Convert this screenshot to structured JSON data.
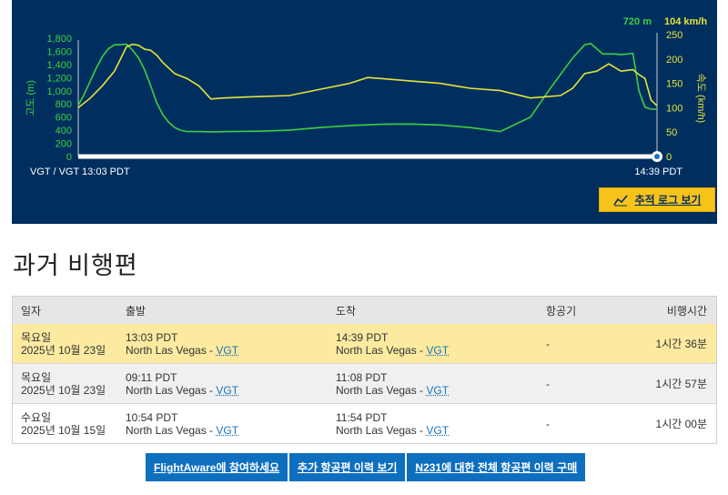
{
  "chart": {
    "altitude_readout": "720 m",
    "speed_readout": "104 km/h",
    "altitude_axis_label": "고도 (m)",
    "speed_axis_label": "속도 (km/h)",
    "start_label": "VGT / VGT 13:03 PDT",
    "end_label": "14:39 PDT",
    "tracklog_button": "추적 로그 보기",
    "colors": {
      "background": "#002f5f",
      "altitude": "#3fcf3f",
      "speed": "#e4e43a",
      "baseline": "#ffffff"
    }
  },
  "chart_data": {
    "type": "line",
    "x_unit": "minutes from 13:03 PDT",
    "x_range": [
      0,
      96
    ],
    "altitude_axis": {
      "ticks": [
        "0",
        "200",
        "400",
        "600",
        "800",
        "1,000",
        "1,200",
        "1,400",
        "1,600",
        "1,800"
      ],
      "ylim": [
        0,
        1850
      ]
    },
    "speed_axis": {
      "ticks": [
        "0",
        "50",
        "100",
        "150",
        "200",
        "250"
      ],
      "ylim": [
        0,
        250
      ]
    },
    "series": [
      {
        "name": "고도 (m)",
        "axis": "altitude",
        "x": [
          0,
          1,
          2,
          3,
          4,
          5,
          6,
          7,
          8,
          9,
          10,
          11,
          12,
          13,
          14,
          15,
          16,
          17,
          18,
          20,
          22,
          25,
          30,
          35,
          40,
          45,
          50,
          55,
          60,
          65,
          70,
          75,
          78,
          80,
          82,
          84,
          85,
          86,
          87,
          88,
          89,
          90,
          92,
          93,
          94,
          95,
          96
        ],
        "y": [
          780,
          950,
          1150,
          1350,
          1520,
          1640,
          1700,
          1700,
          1710,
          1620,
          1500,
          1320,
          1080,
          820,
          640,
          520,
          440,
          400,
          380,
          380,
          375,
          380,
          385,
          400,
          440,
          470,
          490,
          495,
          480,
          440,
          380,
          600,
          1000,
          1250,
          1500,
          1700,
          1720,
          1640,
          1560,
          1560,
          1560,
          1550,
          1570,
          1000,
          750,
          720,
          720
        ]
      },
      {
        "name": "속도 (km/h)",
        "axis": "speed",
        "x": [
          0,
          2,
          4,
          6,
          8,
          9,
          10,
          11,
          12,
          13,
          14,
          16,
          18,
          20,
          22,
          24,
          28,
          35,
          45,
          48,
          50,
          55,
          60,
          65,
          70,
          75,
          80,
          82,
          84,
          86,
          88,
          90,
          92,
          93,
          94,
          95,
          96
        ],
        "y": [
          100,
          120,
          145,
          175,
          225,
          230,
          228,
          220,
          218,
          208,
          193,
          170,
          160,
          145,
          118,
          120,
          122,
          125,
          150,
          162,
          160,
          155,
          150,
          140,
          135,
          120,
          125,
          140,
          170,
          175,
          190,
          175,
          178,
          168,
          160,
          116,
          104
        ]
      }
    ]
  },
  "section_title": "과거 비행편",
  "table": {
    "headers": {
      "date": "일자",
      "departure": "출발",
      "arrival": "도착",
      "aircraft": "항공기",
      "duration": "비행시간"
    },
    "rows": [
      {
        "weekday": "목요일",
        "date": "2025년 10월 23일",
        "dep_time": "13:03 PDT",
        "dep_city": "North Las Vegas - ",
        "dep_code": "VGT",
        "arr_time": "14:39 PDT",
        "arr_city": "North Las Vegas - ",
        "arr_code": "VGT",
        "aircraft": "-",
        "duration": "1시간 36분"
      },
      {
        "weekday": "목요일",
        "date": "2025년 10월 23일",
        "dep_time": "09:11 PDT",
        "dep_city": "North Las Vegas - ",
        "dep_code": "VGT",
        "arr_time": "11:08 PDT",
        "arr_city": "North Las Vegas - ",
        "arr_code": "VGT",
        "aircraft": "-",
        "duration": "1시간 57분"
      },
      {
        "weekday": "수요일",
        "date": "2025년 10월 15일",
        "dep_time": "10:54 PDT",
        "dep_city": "North Las Vegas - ",
        "dep_code": "VGT",
        "arr_time": "11:54 PDT",
        "arr_city": "North Las Vegas - ",
        "arr_code": "VGT",
        "aircraft": "-",
        "duration": "1시간 00분"
      }
    ]
  },
  "buttons": {
    "join": "FlightAware에 참여하세요",
    "more_history": "추가 항공편 이력 보기",
    "buy_history": "N231에 대한 전체 항공편 이력 구매"
  }
}
